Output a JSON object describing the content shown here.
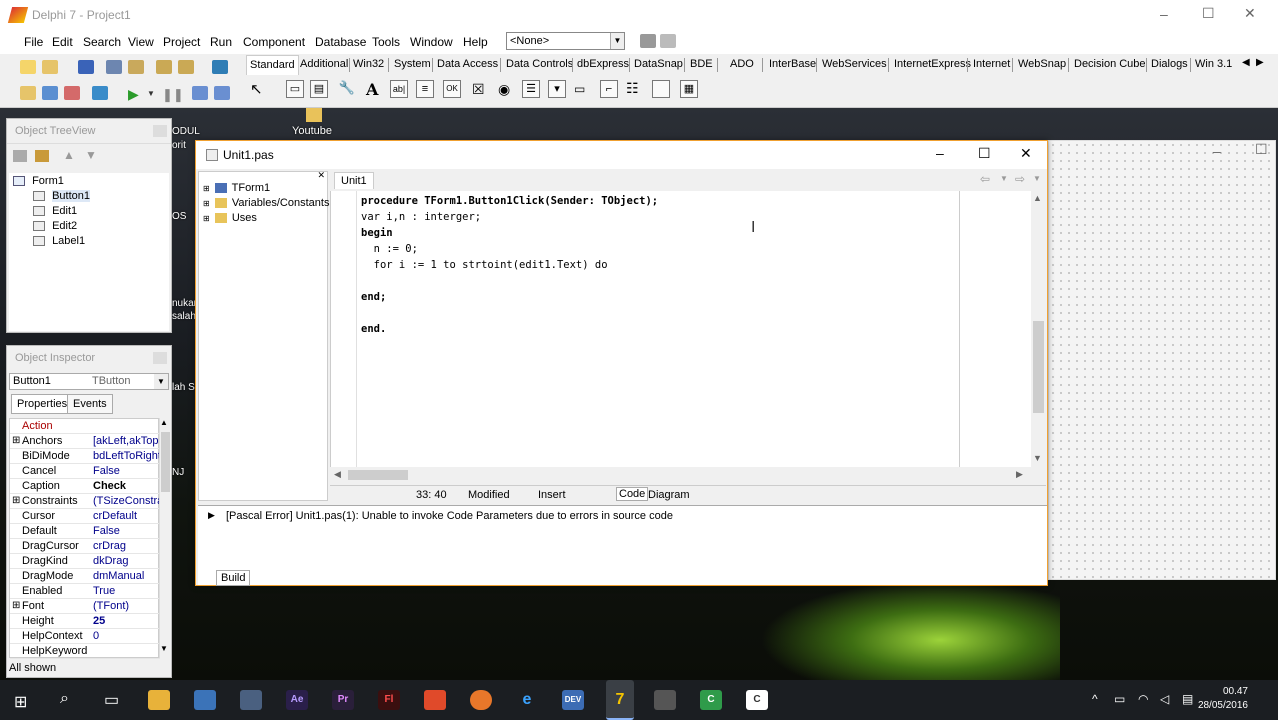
{
  "app": {
    "title": "Delphi 7 - Project1"
  },
  "menu": [
    "File",
    "Edit",
    "Search",
    "View",
    "Project",
    "Run",
    "Component",
    "Database",
    "Tools",
    "Window",
    "Help"
  ],
  "toolbar": {
    "combo_value": "<None>"
  },
  "palette": {
    "tabs": [
      "Standard",
      "Additional",
      "Win32",
      "System",
      "Data Access",
      "Data Controls",
      "dbExpress",
      "DataSnap",
      "BDE",
      "ADO",
      "InterBase",
      "WebServices",
      "InternetExpress",
      "Internet",
      "WebSnap",
      "Decision Cube",
      "Dialogs",
      "Win 3.1"
    ]
  },
  "desktop": {
    "icon_label": "Youtube",
    "peek1": "ODUL",
    "peek2": "orit",
    "peek3": "OS",
    "peek4": "nukar",
    "peek5": "salah",
    "peek6": "lah S",
    "peek7": "NJ"
  },
  "treeview": {
    "title": "Object TreeView",
    "items": [
      "Form1",
      "Button1",
      "Edit1",
      "Edit2",
      "Label1"
    ]
  },
  "inspector": {
    "title": "Object Inspector",
    "selected_object": "Button1",
    "selected_type": "TButton",
    "tabs": [
      "Properties",
      "Events"
    ],
    "rows": [
      {
        "name": "Action",
        "value": "",
        "exp": ""
      },
      {
        "name": "Anchors",
        "value": "[akLeft,akTop",
        "exp": "⊞"
      },
      {
        "name": "BiDiMode",
        "value": "bdLeftToRight",
        "exp": ""
      },
      {
        "name": "Cancel",
        "value": "False",
        "exp": ""
      },
      {
        "name": "Caption",
        "value": "Check",
        "exp": ""
      },
      {
        "name": "Constraints",
        "value": "(TSizeConstra",
        "exp": "⊞"
      },
      {
        "name": "Cursor",
        "value": "crDefault",
        "exp": ""
      },
      {
        "name": "Default",
        "value": "False",
        "exp": ""
      },
      {
        "name": "DragCursor",
        "value": "crDrag",
        "exp": ""
      },
      {
        "name": "DragKind",
        "value": "dkDrag",
        "exp": ""
      },
      {
        "name": "DragMode",
        "value": "dmManual",
        "exp": ""
      },
      {
        "name": "Enabled",
        "value": "True",
        "exp": ""
      },
      {
        "name": "Font",
        "value": "(TFont)",
        "exp": "⊞"
      },
      {
        "name": "Height",
        "value": "25",
        "exp": ""
      },
      {
        "name": "HelpContext",
        "value": "0",
        "exp": ""
      },
      {
        "name": "HelpKeyword",
        "value": "",
        "exp": ""
      }
    ],
    "status": "All shown"
  },
  "editor": {
    "title": "Unit1.pas",
    "tab": "Unit1",
    "explorer": [
      "TForm1",
      "Variables/Constants",
      "Uses"
    ],
    "code_lines": [
      "procedure TForm1.Button1Click(Sender: TObject);",
      "var i,n : interger;",
      "begin",
      "  n := 0;",
      "  for i := 1 to strtoint(edit1.Text) do",
      "",
      "end;",
      "",
      "end."
    ],
    "status": {
      "position": "33: 40",
      "modified": "Modified",
      "mode": "Insert",
      "tab_code": "Code",
      "tab_diagram": "Diagram"
    },
    "message": "[Pascal Error] Unit1.pas(1): Unable to invoke Code Parameters due to errors in source code",
    "build_tab": "Build"
  },
  "taskbar": {
    "time": "00.47",
    "date": "28/05/2016"
  },
  "colors": {
    "accent_orange": "#f0a030",
    "taskbar": "#1b1e22"
  }
}
